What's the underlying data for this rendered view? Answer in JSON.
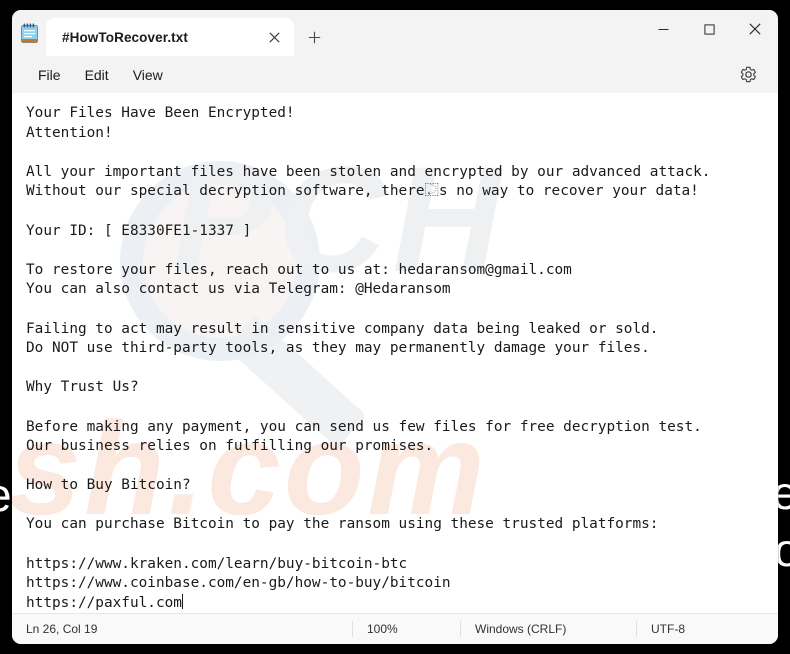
{
  "window": {
    "app_icon": "notepad-icon",
    "tab": {
      "title": "#HowToRecover.txt",
      "close_icon": "close-icon"
    },
    "new_tab_icon": "plus-icon",
    "controls": {
      "minimize_icon": "minimize-icon",
      "maximize_icon": "maximize-icon",
      "close_icon": "close-icon"
    }
  },
  "menubar": {
    "items": [
      {
        "label": "File"
      },
      {
        "label": "Edit"
      },
      {
        "label": "View"
      }
    ],
    "settings_icon": "gear-icon"
  },
  "editor": {
    "watermark_top": "PCH",
    "watermark_bottom": "ish.com",
    "content": "Your Files Have Been Encrypted!\nAttention!\n\nAll your important files have been stolen and encrypted by our advanced attack.\nWithout our special decryption software, there⿿s no way to recover your data!\n\nYour ID: [ E8330FE1-1337 ]\n\nTo restore your files, reach out to us at: hedaransom@gmail.com\nYou can also contact us via Telegram: @Hedaransom\n\nFailing to act may result in sensitive company data being leaked or sold.\nDo NOT use third-party tools, as they may permanently damage your files.\n\nWhy Trust Us?\n\nBefore making any payment, you can send us few files for free decryption test.\nOur business relies on fulfilling our promises.\n\nHow to Buy Bitcoin?\n\nYou can purchase Bitcoin to pay the ransom using these trusted platforms:\n\nhttps://www.kraken.com/learn/buy-bitcoin-btc\nhttps://www.coinbase.com/en-gb/how-to-buy/bitcoin\nhttps://paxful.com"
  },
  "statusbar": {
    "position": "Ln 26, Col 19",
    "zoom": "100%",
    "line_endings": "Windows (CRLF)",
    "encoding": "UTF-8"
  },
  "backdrop": {
    "glyph_left": "e",
    "glyph_right_1": "e",
    "glyph_right_2": "o"
  },
  "colors": {
    "window_chrome": "#f3f3f3",
    "editor_bg": "#ffffff",
    "text": "#1a1a1a",
    "watermark_gray": "#eef0f2",
    "watermark_peach": "#fbe9e0",
    "backdrop": "#000000"
  }
}
